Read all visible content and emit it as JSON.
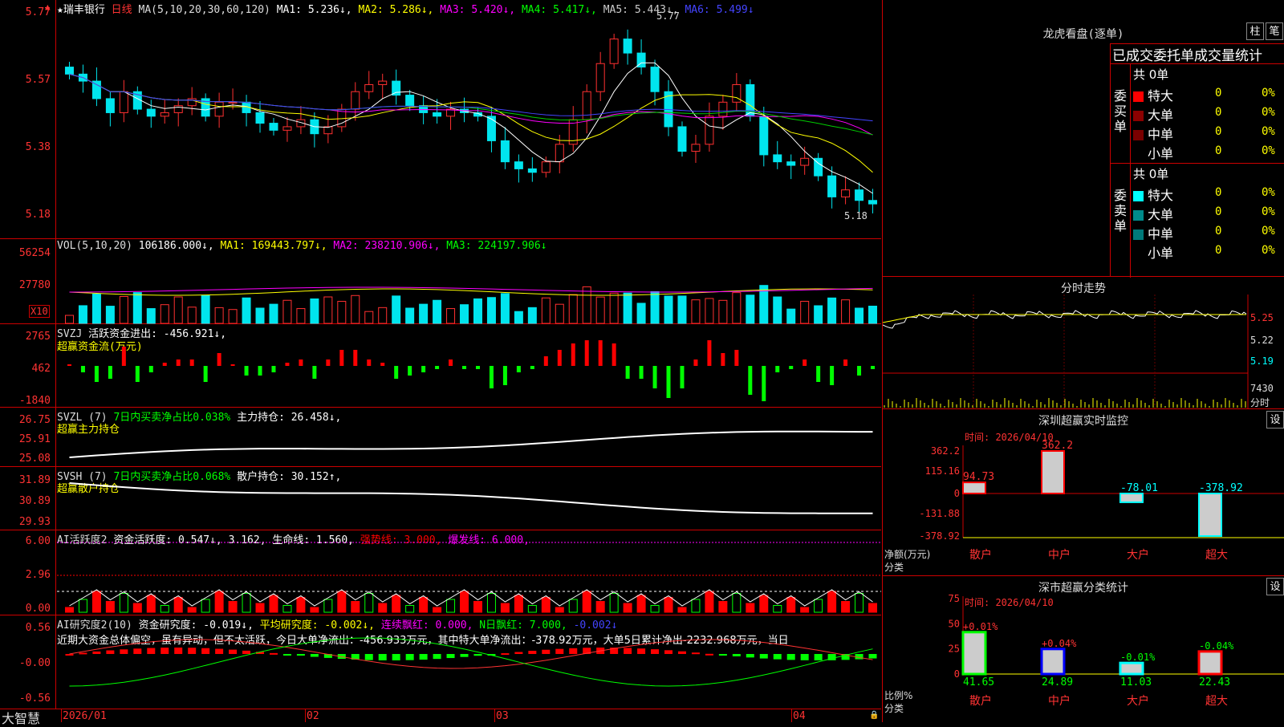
{
  "kline": {
    "header": {
      "name": "★瑞丰银行",
      "period": "日线",
      "ma_params": "MA(5,10,20,30,60,120)",
      "ma1": "MA1: 5.236↓,",
      "ma2": "MA2: 5.286↓,",
      "ma3": "MA3: 5.420↓,",
      "ma4": "MA4: 5.417↓,",
      "ma5": "MA5: 5.443↓,",
      "ma6": "MA6: 5.499↓"
    },
    "yticks": [
      "5.77",
      "5.57",
      "5.38",
      "5.18"
    ],
    "high_label": "5.77",
    "low_label": "5.18",
    "close": [
      5.6,
      5.58,
      5.53,
      5.49,
      5.55,
      5.5,
      5.48,
      5.49,
      5.51,
      5.53,
      5.48,
      5.52,
      5.52,
      5.49,
      5.46,
      5.44,
      5.45,
      5.47,
      5.43,
      5.45,
      5.5,
      5.55,
      5.57,
      5.58,
      5.54,
      5.51,
      5.49,
      5.48,
      5.5,
      5.49,
      5.48,
      5.41,
      5.35,
      5.33,
      5.32,
      5.35,
      5.4,
      5.47,
      5.55,
      5.63,
      5.7,
      5.66,
      5.62,
      5.55,
      5.45,
      5.38,
      5.4,
      5.48,
      5.52,
      5.57,
      5.48,
      5.37,
      5.35,
      5.34,
      5.36,
      5.31,
      5.25,
      5.27,
      5.24,
      5.23
    ]
  },
  "vol": {
    "header": {
      "label": "VOL(5,10,20)",
      "value": "106186.000↓,",
      "ma1": "MA1: 169443.797↓,",
      "ma2": "MA2: 238210.906↓,",
      "ma3": "MA3: 224197.906↓"
    },
    "yticks": [
      "56254",
      "27780"
    ],
    "unit": "X10"
  },
  "svzj": {
    "header": {
      "label": "SVZJ",
      "desc": "活跃资金进出: -456.921↓,"
    },
    "sub": "超赢资金流(万元)",
    "yticks": [
      "2765",
      "462",
      "-1840"
    ]
  },
  "svzl": {
    "header": {
      "label": "SVZL (7)",
      "desc": "7日内买卖净占比0.038%",
      "main": "主力持仓: 26.458↓,"
    },
    "sub": "超赢主力持仓",
    "yticks": [
      "26.75",
      "25.91",
      "25.08"
    ]
  },
  "svsh": {
    "header": {
      "label": "SVSH (7)",
      "desc": "7日内买卖净占比0.068%",
      "main": "散户持仓: 30.152↑,"
    },
    "sub": "超赢散户持仓",
    "yticks": [
      "31.89",
      "30.89",
      "29.93"
    ]
  },
  "ai1": {
    "header": {
      "label": "AI活跃度2",
      "a": "资金活跃度: 0.547↓, 3.162,",
      "b": "生命线: 1.560,",
      "c": "强势线: 3.000,",
      "d": "爆发线: 6.000,"
    },
    "yticks": [
      "6.00",
      "2.96",
      "0.00"
    ]
  },
  "ai2": {
    "header": {
      "label": "AI研究度2(10)",
      "a": "资金研究度: -0.019↓,",
      "b": "平均研究度: -0.002↓,",
      "c": "连续飘红: 0.000,",
      "d": "N日飘红: 7.000,",
      "e": "-0.002↓"
    },
    "comment": "近期大资金总体偏空，虽有异动，但不太活跃，今日大单净流出：-456.933万元，其中特大单净流出：-378.92万元，大单5日累计净出-2232.968万元，当日",
    "yticks": [
      "0.56",
      "-0.00",
      "-0.56"
    ]
  },
  "xaxis": {
    "labels": [
      "2026/01",
      "02",
      "03",
      "04"
    ]
  },
  "brand": "大智慧",
  "lhb": {
    "title": "龙虎看盘(逐单)",
    "btn1": "柱",
    "btn2": "笔",
    "subtitle": "已成交委托单成交量统计",
    "buy": {
      "side": "委买单",
      "total": "共 0单",
      "rows": [
        {
          "name": "特大",
          "v": "0",
          "p": "0%",
          "color": "#ff0000"
        },
        {
          "name": "大单",
          "v": "0",
          "p": "0%",
          "color": "#8b0000"
        },
        {
          "name": "中单",
          "v": "0",
          "p": "0%",
          "color": "#7a0000"
        },
        {
          "name": "小单",
          "v": "0",
          "p": "0%",
          "color": "#000000"
        }
      ]
    },
    "sell": {
      "side": "委卖单",
      "total": "共 0单",
      "rows": [
        {
          "name": "特大",
          "v": "0",
          "p": "0%",
          "color": "#00ffff"
        },
        {
          "name": "大单",
          "v": "0",
          "p": "0%",
          "color": "#008b8b"
        },
        {
          "name": "中单",
          "v": "0",
          "p": "0%",
          "color": "#007a7a"
        },
        {
          "name": "小单",
          "v": "0",
          "p": "0%",
          "color": "#000000"
        }
      ]
    }
  },
  "fenshi": {
    "title": "分时走势",
    "yticks": [
      "5.25",
      "5.22",
      "5.19"
    ],
    "vol_label": "7430",
    "vol_unit": "分时"
  },
  "monitor": {
    "title": "深圳超赢实时监控",
    "btn": "设",
    "time": "时间: 2026/04/10",
    "yticks": [
      "362.2",
      "115.16",
      "0",
      "-131.88",
      "-378.92"
    ],
    "ylabel1": "净额(万元)",
    "ylabel2": "分类",
    "bars": [
      {
        "cat": "散户",
        "value": 94.73,
        "label": "94.73"
      },
      {
        "cat": "中户",
        "value": 362.2,
        "label": "362.2"
      },
      {
        "cat": "大户",
        "value": -78.01,
        "label": "-78.01"
      },
      {
        "cat": "超大",
        "value": -378.92,
        "label": "-378.92"
      }
    ]
  },
  "classify": {
    "title": "深市超赢分类统计",
    "btn": "设",
    "time": "时间: 2026/04/10",
    "yticks": [
      "75",
      "50",
      "25",
      "0"
    ],
    "ylabel1": "比例%",
    "ylabel2": "分类",
    "bars": [
      {
        "cat": "散户",
        "value": 41.65,
        "label": "41.65",
        "change": "+0.01%"
      },
      {
        "cat": "中户",
        "value": 24.89,
        "label": "24.89",
        "change": "+0.04%"
      },
      {
        "cat": "大户",
        "value": 11.03,
        "label": "11.03",
        "change": "-0.01%"
      },
      {
        "cat": "超大",
        "value": 22.43,
        "label": "22.43",
        "change": "-0.04%"
      }
    ]
  }
}
